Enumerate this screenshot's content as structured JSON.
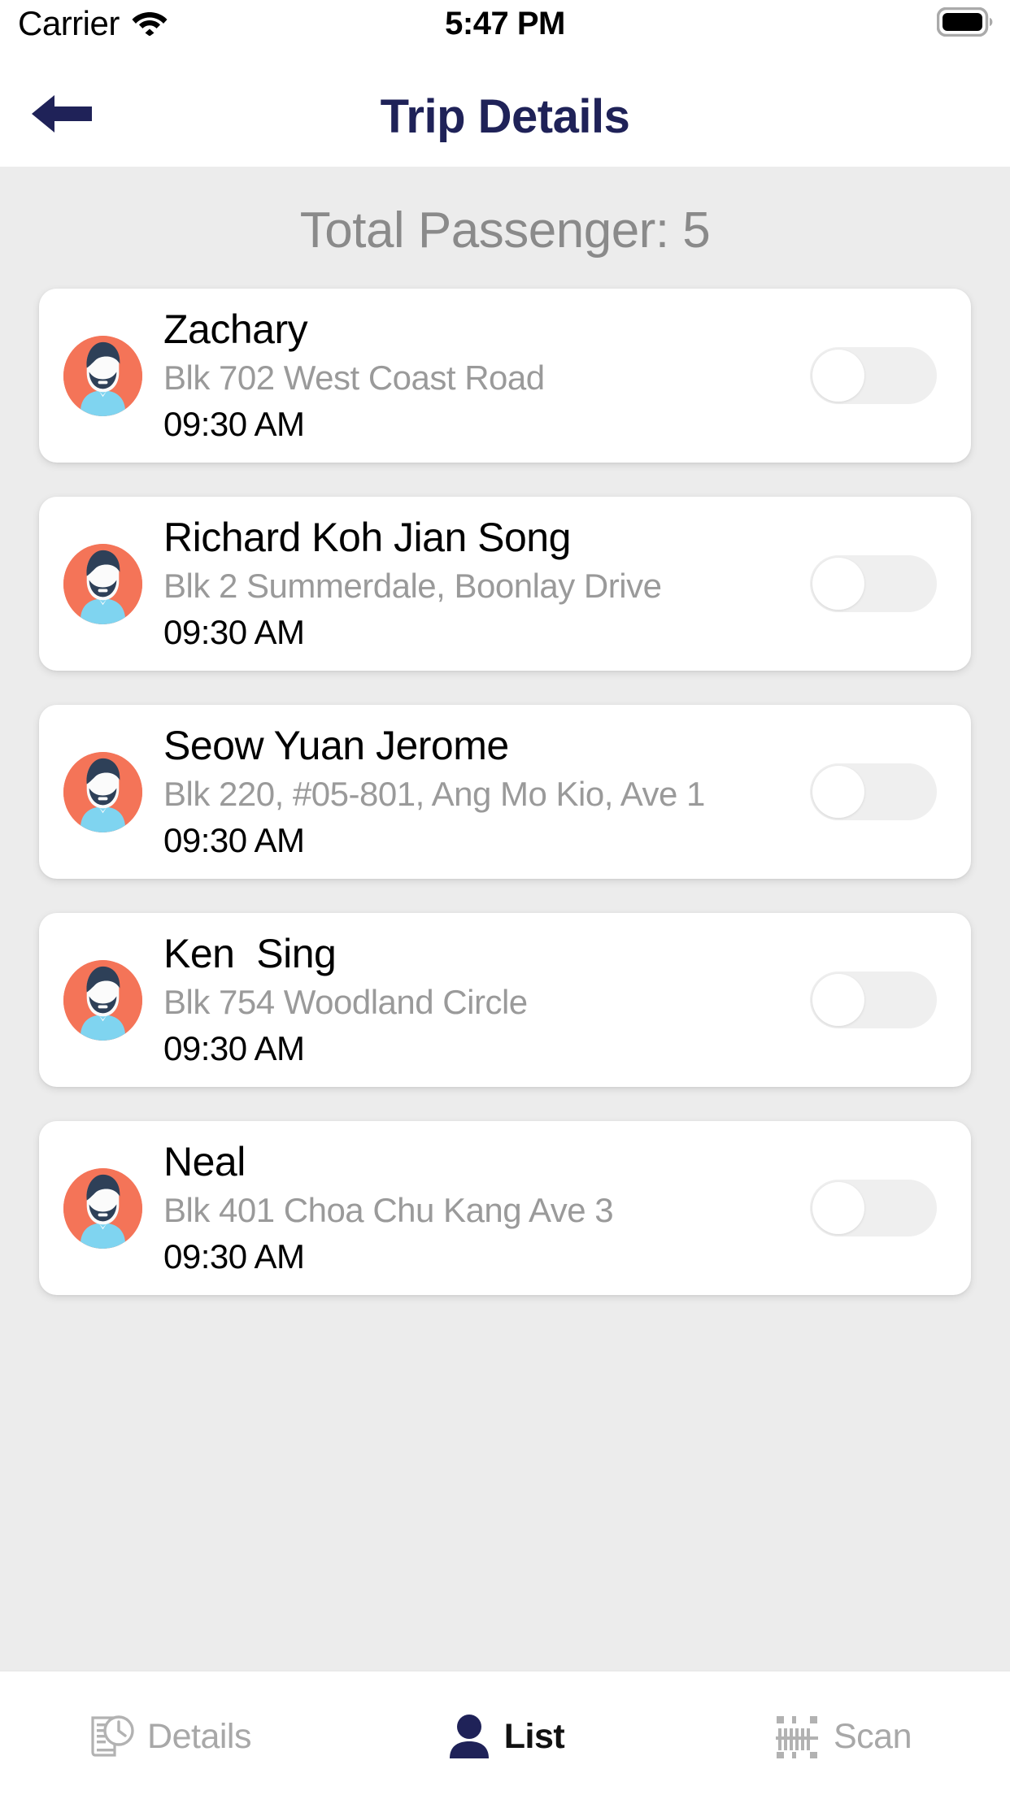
{
  "status_bar": {
    "carrier": "Carrier",
    "wifi_icon": "wifi-icon",
    "time": "5:47 PM",
    "battery_icon": "battery-full-icon"
  },
  "nav": {
    "back_icon": "arrow-left-icon",
    "title": "Trip Details",
    "title_color": "#1F2258"
  },
  "main": {
    "summary": "Total Passenger: 5",
    "background_color": "#ECECEC",
    "passengers": [
      {
        "name": "Zachary",
        "address": "Blk 702 West Coast Road",
        "time": "09:30 AM",
        "toggle_on": false,
        "avatar_icon": "user-avatar-icon"
      },
      {
        "name": "Richard Koh Jian Song",
        "address": "Blk 2 Summerdale, Boonlay Drive",
        "time": "09:30 AM",
        "toggle_on": false,
        "avatar_icon": "user-avatar-icon"
      },
      {
        "name": "Seow Yuan Jerome",
        "address": "Blk 220, #05-801, Ang Mo Kio, Ave 1",
        "time": "09:30 AM",
        "toggle_on": false,
        "avatar_icon": "user-avatar-icon"
      },
      {
        "name": "Ken  Sing",
        "address": "Blk 754 Woodland Circle",
        "time": "09:30 AM",
        "toggle_on": false,
        "avatar_icon": "user-avatar-icon"
      },
      {
        "name": "Neal",
        "address": "Blk 401 Choa Chu Kang Ave 3",
        "time": "09:30 AM",
        "toggle_on": false,
        "avatar_icon": "user-avatar-icon"
      }
    ]
  },
  "tabbar": {
    "tabs": [
      {
        "label": "Details",
        "icon": "document-clock-icon",
        "active": false
      },
      {
        "label": "List",
        "icon": "person-icon",
        "active": true
      },
      {
        "label": "Scan",
        "icon": "barcode-scan-icon",
        "active": false
      }
    ],
    "active_color": "#1F2258",
    "inactive_color": "#A8A8A8"
  },
  "colors": {
    "avatar_background": "#F47458",
    "avatar_hair": "#2E4058",
    "avatar_shirt": "#7FD4F0",
    "avatar_face": "#FBFBFB",
    "card_background": "#FFFFFF",
    "toggle_track": "#EFEFEF",
    "toggle_knob": "#FFFFFF"
  }
}
